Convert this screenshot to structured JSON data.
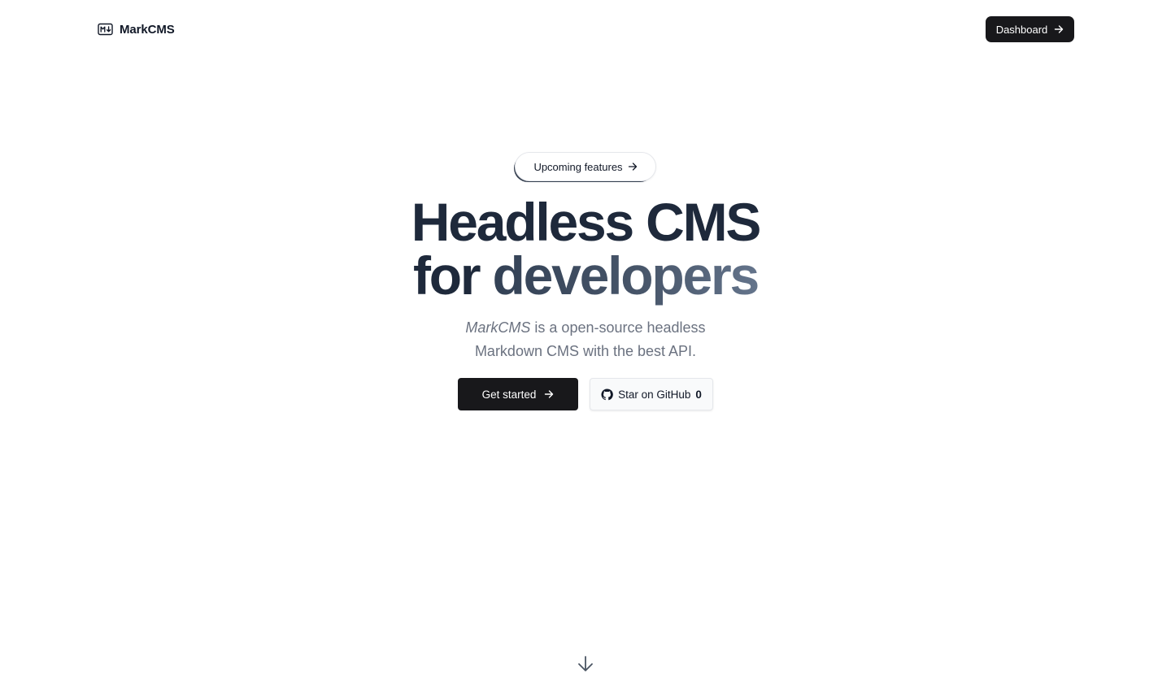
{
  "header": {
    "brand_name": "MarkCMS",
    "dashboard_label": "Dashboard"
  },
  "hero": {
    "pill_label": "Upcoming features",
    "headline_line1": "Headless CMS",
    "headline_line2_prefix": "for",
    "headline_line2_accent": "developers",
    "subtitle_em": "MarkCMS",
    "subtitle_rest": " is a open-source headless",
    "subtitle_line2": "Markdown CMS with the best API.",
    "cta_label": "Get started",
    "github_label": "Star on GitHub",
    "github_count": "0"
  },
  "icons": {
    "brand": "markdown-icon",
    "dashboard_arrow": "arrow-right-icon",
    "pill_arrow": "arrow-right-icon",
    "cta_arrow": "arrow-right-icon",
    "github": "github-icon",
    "scroll": "arrow-down-icon"
  },
  "colors": {
    "primary_button": "#18181b",
    "headline": "#1e293b",
    "subtitle": "#6b7280"
  }
}
